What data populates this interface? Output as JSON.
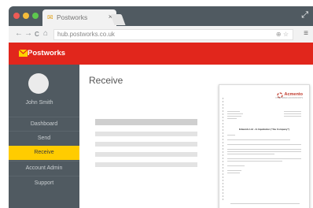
{
  "browser": {
    "tab_title": "Postworks",
    "tab_close": "×",
    "url": "hub.postworks.co.uk",
    "icons": {
      "back": "←",
      "forward": "→",
      "reload": "C",
      "home": "⌂",
      "zoom": "⊕",
      "star": "☆",
      "menu": "≡",
      "expand": "⤢"
    },
    "dots": [
      "#ee5b55",
      "#f4bd3a",
      "#5ec84e"
    ]
  },
  "app": {
    "brand": "Postworks",
    "colors": {
      "brand_red": "#e1261c",
      "accent_yellow": "#ffcc00",
      "sidebar": "#505a61"
    }
  },
  "sidebar": {
    "user_name": "John Smith",
    "items": [
      {
        "label": "Dashboard",
        "active": false
      },
      {
        "label": "Send",
        "active": false
      },
      {
        "label": "Receive",
        "active": true
      },
      {
        "label": "Account Admin",
        "active": false
      },
      {
        "label": "Support",
        "active": false
      }
    ]
  },
  "main": {
    "title": "Receive"
  },
  "document": {
    "logo": "Acmento",
    "logo_tagline": "CHARTERED ACCOUNTANTS",
    "title": "Edwards Ltd - In liquidation (\"the Company\")"
  }
}
